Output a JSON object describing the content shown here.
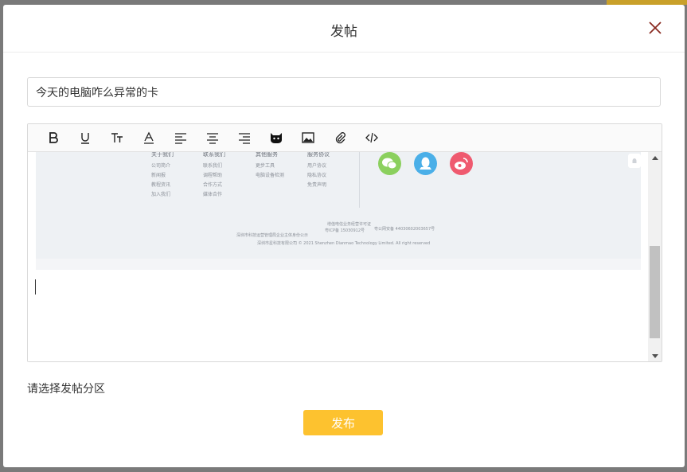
{
  "modal": {
    "title": "发帖",
    "title_input_value": "今天的电脑咋么异常的卡",
    "section_label": "请选择发帖分区",
    "publish_label": "发布"
  },
  "toolbar": {
    "icons": [
      "bold-icon",
      "underline-icon",
      "text-size-icon",
      "font-color-icon",
      "align-left-icon",
      "align-center-icon",
      "align-right-icon",
      "emoji-icon",
      "image-icon",
      "attachment-icon",
      "code-icon"
    ]
  },
  "embedded_footer": {
    "columns": [
      {
        "heading": "关于我们",
        "items": [
          "公司简介",
          "新闻报",
          "教程资讯",
          "加入我们"
        ]
      },
      {
        "heading": "联系我们",
        "items": [
          "联系我们",
          "调程帮助",
          "合作方式",
          "媒体合作"
        ]
      },
      {
        "heading": "其他服务",
        "items": [
          "更步工具",
          "电脑设备检测"
        ]
      },
      {
        "heading": "服务协议",
        "items": [
          "用户协议",
          "隐私协议",
          "免责声明"
        ]
      }
    ],
    "social_icons": [
      "wechat-icon",
      "qq-icon",
      "weibo-icon"
    ],
    "line1": "增值电信业务经营许可证",
    "line2": "粤ICP备 15030912号",
    "broken_image_alt": "深圳市科技运营管理局企业主体身份公示",
    "police_record": "粤公网安备 44030602003657号",
    "copyright": "深圳市星科技有限公司 © 2021 Shenzhen Dianmao Technology Limited. All right reserved"
  },
  "colors": {
    "accent": "#fdc22f",
    "close": "#8b2b22",
    "wechat": "#8bd05e",
    "qq": "#4aafe8",
    "weibo": "#ef5a6f"
  }
}
